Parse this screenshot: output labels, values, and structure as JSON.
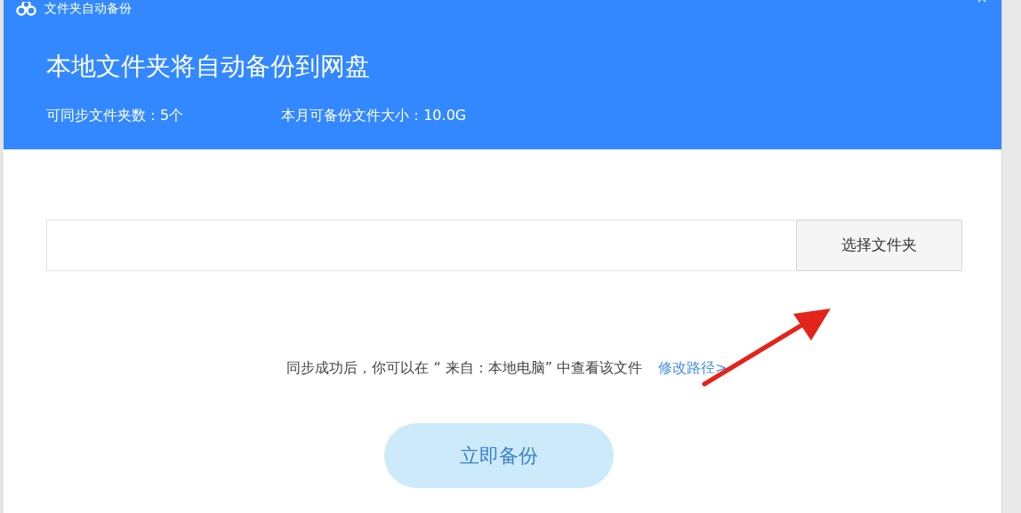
{
  "window": {
    "title": "文件夹自动备份"
  },
  "header": {
    "heading": "本地文件夹将自动备份到网盘",
    "stats": [
      "可同步文件夹数：5个",
      "本月可备份文件大小：10.0G"
    ]
  },
  "folder_picker": {
    "button": "选择文件夹"
  },
  "hint": {
    "text": "同步成功后，你可以在 “ 来自：本地电脑” 中查看该文件",
    "link": "修改路径>"
  },
  "primary_button": {
    "label": "立即备份",
    "disabled": true
  }
}
